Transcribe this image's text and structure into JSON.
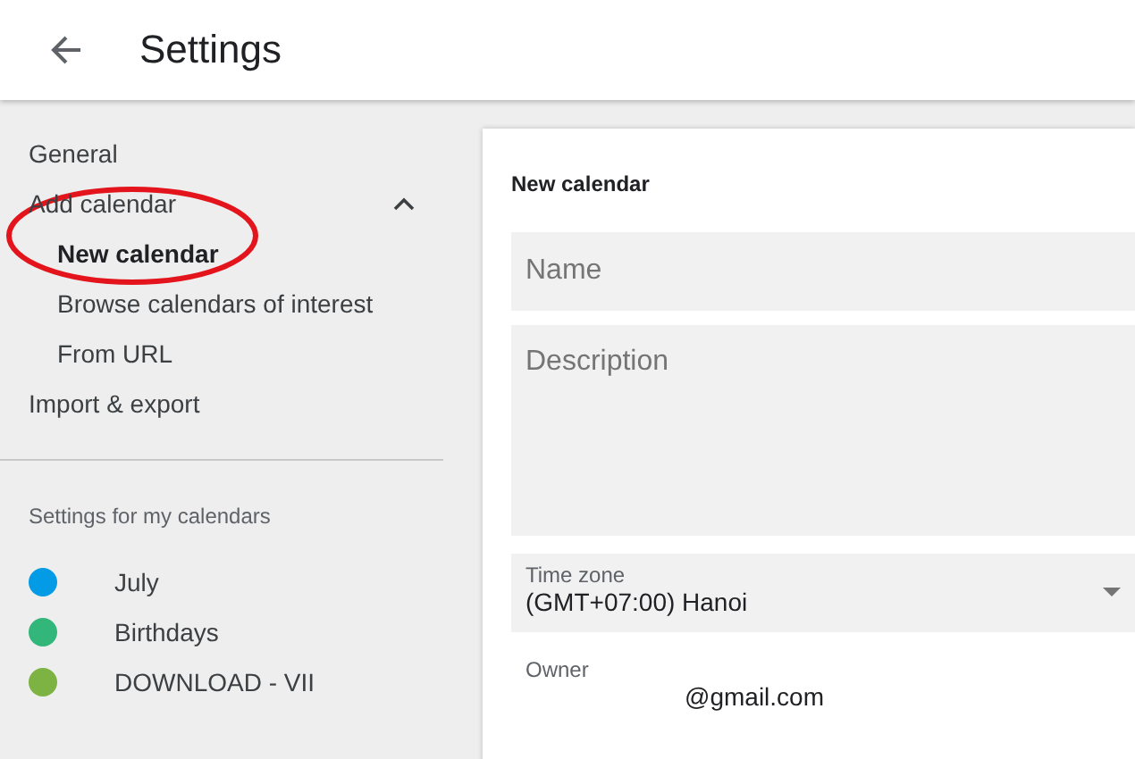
{
  "header": {
    "title": "Settings"
  },
  "sidebar": {
    "items": [
      {
        "label": "General",
        "selected": false
      },
      {
        "label": "Add calendar",
        "selected": false,
        "expanded": true,
        "children": [
          {
            "label": "New calendar",
            "selected": true
          },
          {
            "label": "Browse calendars of interest",
            "selected": false
          },
          {
            "label": "From URL",
            "selected": false
          }
        ]
      },
      {
        "label": "Import & export",
        "selected": false
      }
    ],
    "section_title": "Settings for my calendars",
    "calendars": [
      {
        "name": "July",
        "color": "#039be5"
      },
      {
        "name": "Birthdays",
        "color": "#33b679"
      },
      {
        "name": "DOWNLOAD - VII",
        "color": "#7cb342"
      }
    ]
  },
  "form": {
    "title": "New calendar",
    "name": {
      "placeholder": "Name"
    },
    "description": {
      "placeholder": "Description"
    },
    "time_zone": {
      "label": "Time zone",
      "value": "(GMT+07:00) Hanoi"
    },
    "owner": {
      "label": "Owner",
      "value": "@gmail.com"
    }
  }
}
